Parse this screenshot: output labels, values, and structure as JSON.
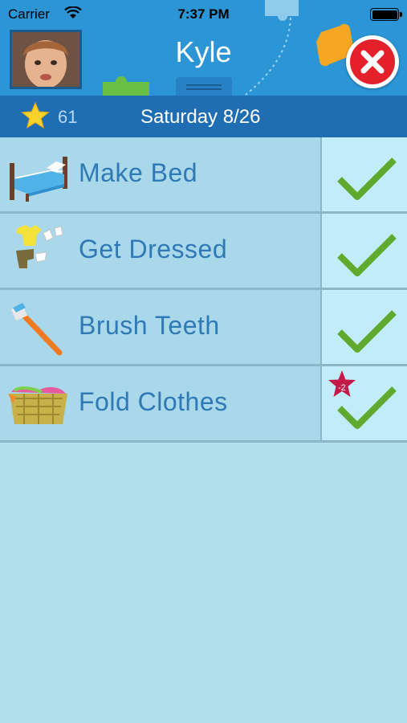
{
  "status_bar": {
    "carrier": "Carrier",
    "time": "7:37 PM"
  },
  "header": {
    "child_name": "Kyle",
    "avatar_icon": "child-photo",
    "close_icon": "close-icon"
  },
  "stats": {
    "stars": "61",
    "date": "Saturday 8/26"
  },
  "tasks": [
    {
      "label": "Make Bed",
      "icon": "bed-icon",
      "completed": true
    },
    {
      "label": "Get Dressed",
      "icon": "clothes-icon",
      "completed": true
    },
    {
      "label": "Brush Teeth",
      "icon": "toothbrush-icon",
      "completed": true
    },
    {
      "label": "Fold Clothes",
      "icon": "laundry-basket-icon",
      "completed": true,
      "penalty": "-2"
    }
  ],
  "colors": {
    "header": "#2b95d6",
    "stats_bar": "#1f6eb3",
    "row": "#a8d8e9",
    "check_cell": "#c3ecfa",
    "check": "#5faa2e",
    "text": "#2f79b6"
  }
}
